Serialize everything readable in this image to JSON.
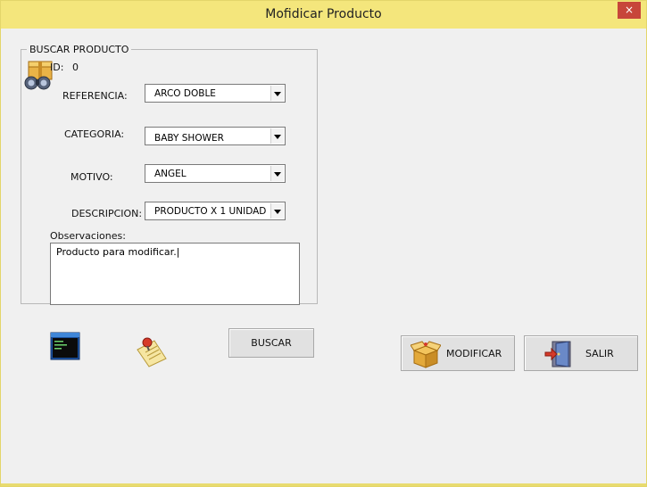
{
  "window": {
    "title": "Mofidicar Producto",
    "close_glyph": "×"
  },
  "search_group": {
    "legend": "BUSCAR PRODUCTO",
    "id_label": "ID:",
    "id_value": "0",
    "fields": {
      "referencia": {
        "label": "REFERENCIA:",
        "value": "ARCO DOBLE"
      },
      "categoria": {
        "label": "CATEGORIA:",
        "value": "BABY SHOWER"
      },
      "motivo": {
        "label": "MOTIVO:",
        "value": "ANGEL"
      },
      "descripcion": {
        "label": "DESCRIPCION:",
        "value": "PRODUCTO X 1 UNIDAD"
      }
    },
    "observaciones": {
      "label": "Observaciones:",
      "value": "Producto para modificar.|"
    }
  },
  "buttons": {
    "buscar": "BUSCAR",
    "modificar": "MODIFICAR",
    "salir": "SALIR"
  },
  "icons": {
    "search": "binoculars-box-icon",
    "terminal": "terminal-icon",
    "note": "note-pin-icon",
    "modify": "open-box-icon",
    "exit": "exit-door-icon"
  },
  "colors": {
    "titlebar": "#f4e67c",
    "close": "#c7463a",
    "window": "#f0f0f0"
  }
}
